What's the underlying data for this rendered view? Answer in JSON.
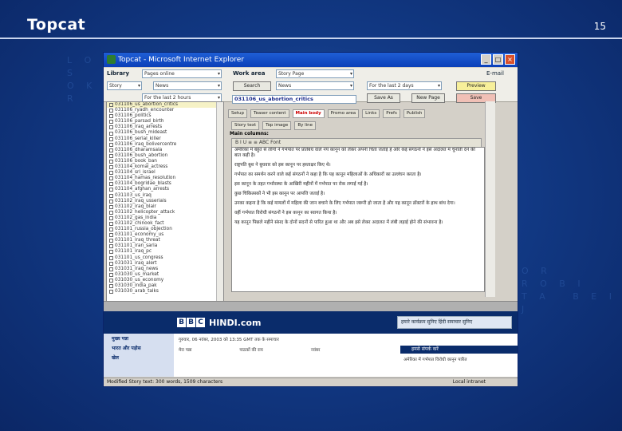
{
  "slide": {
    "title": "Topcat",
    "number": "15"
  },
  "window": {
    "title": "Topcat - Microsoft Internet Explorer"
  },
  "toolbar": {
    "library_label": "Library",
    "library_value": "Pages online",
    "story_value": "Story",
    "news_value": "News",
    "left_sel3": "For the last 2 hours",
    "workarea_label": "Work area",
    "workarea_value": "Story Page",
    "search_button": "Search",
    "news2_value": "News",
    "last_value": "For the last 2 days",
    "preview_button": "Preview",
    "save_as_button": "Save As",
    "new_page_button": "New Page",
    "save_button": "Save",
    "filename": "031106_us_abortion_critics",
    "right_hint": "E-mail"
  },
  "story_list": [
    "031106_us_abortion_critics",
    "031106_ryadh_encounter",
    "031106_politics",
    "031106_parsad_birth",
    "031106_iraq_arrests",
    "031106_bush_mideast",
    "031106_serial_killer",
    "031106_iraq_bolivercentre",
    "031106_dharamsala",
    "031106_bush_abortion",
    "031106_book_ban",
    "031104_komal_actress",
    "031104_sri_israel",
    "031104_hamas_resolution",
    "031104_bogridae_blasts",
    "031104_afghan_arrests",
    "031103_us_iraq",
    "031102_iraq_usserials",
    "031102_iraq_blair",
    "031102_helicopter_attack",
    "031102_gas_india",
    "031102_chinook_fact",
    "031101_russia_objection",
    "031101_economy_us",
    "031101_iraq_threat",
    "031101_iran_saria",
    "031101_iraq_pc",
    "031101_us_congress",
    "031031_iraq_alert",
    "031031_iraq_news",
    "031030_us_market",
    "031030_us_economy",
    "031030_india_pak",
    "031030_arab_talks"
  ],
  "tabs_row1": [
    "Setup",
    "Teaser content",
    "Main body",
    "Promo area",
    "Links",
    "Prefs",
    "Publish"
  ],
  "tabs_row2": [
    "Story text",
    "Top image",
    "By line"
  ],
  "main_columns_label": "Main columns:",
  "format_bar": "B  I  U   ≡  ≡   ABC   Font",
  "editor_paragraphs": [
    "अमेरिका में बहुत से लोगों ने गर्भपात पर प्रतिबंध वाले नये कानून को लेकर अपनी चिंता जताई है और कई संगठनों ने इसे अदालत में चुनौती देने की बात कही है।",
    "राष्ट्रपति बुश ने बुधवार को इस कानून पर हस्ताक्षर किए थे।",
    "गर्भपात का समर्थन करने वाले कई संगठनों ने कहा है कि यह कानून महिलाओं के अधिकारों का उल्लंघन करता है।",
    "इस कानून के तहत गर्भावस्था के आखिरी महीनों में गर्भपात पर रोक लगाई गई है।",
    "कुछ चिकित्सकों ने भी इस कानून पर आपत्ति जताई है।",
    "उनका कहना है कि कई मामलों में महिला की जान बचाने के लिए गर्भपात जरूरी हो जाता है और यह कानून डॉक्टरों के हाथ बांध देगा।",
    "वहीं गर्भपात विरोधी संगठनों ने इस कानून का स्वागत किया है।",
    "यह कानून पिछले महीने संसद के दोनों सदनों से पारित हुआ था और अब इसे लेकर अदालत में लंबी लड़ाई होने की संभावना है।"
  ],
  "bbc": {
    "logo_letters": [
      "B",
      "B",
      "C"
    ],
    "site_name": "HINDI.com",
    "search_text": "हमारे कार्यक्रम सुनिए हिंदी समाचार सुनिए",
    "nav": [
      "मुख्य पन्ना",
      "भारत और पड़ोस",
      "खेल"
    ],
    "date_line": "गुरुवार, 06 नवंबर, 2003 को 13:35 GMT तक के समाचार",
    "row_items": [
      "मेरा पन्ना",
      "पाठकों की राय",
      "नवंबर"
    ],
    "side_title": "हमसे संपर्क करें",
    "side_line": "अमेरिका में गर्भपात विरोधी कानून पारित"
  },
  "status": {
    "left": "Modified    Story text: 300 words, 1509 characters",
    "right": "Local intranet"
  }
}
